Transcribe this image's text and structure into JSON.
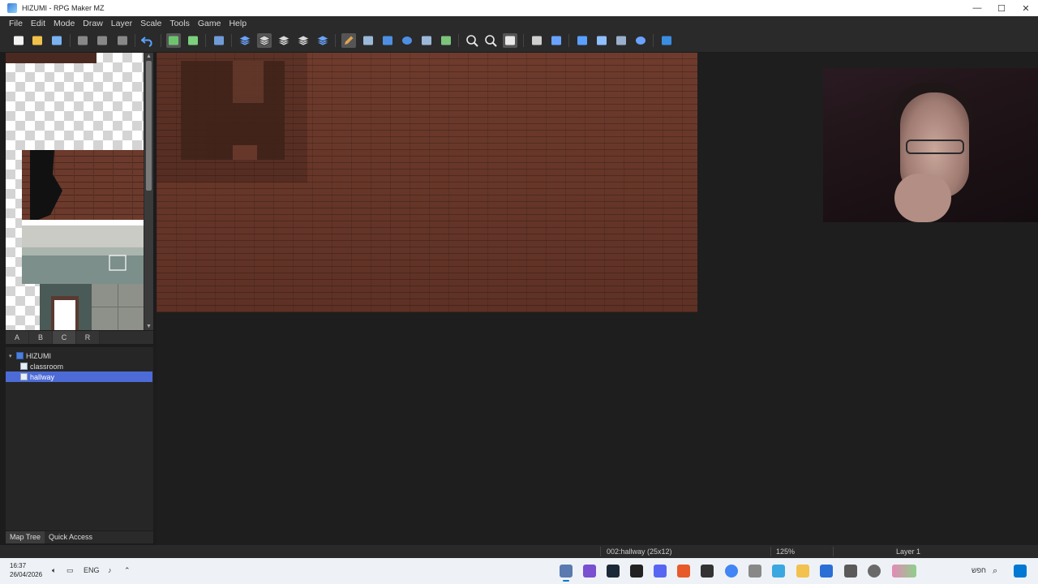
{
  "window": {
    "title": "HIZUMI - RPG Maker MZ",
    "minimize": "—",
    "maximize": "☐",
    "close": "✕"
  },
  "menu": [
    "File",
    "Edit",
    "Mode",
    "Draw",
    "Layer",
    "Scale",
    "Tools",
    "Game",
    "Help"
  ],
  "toolbar": [
    {
      "name": "new-project-icon",
      "color": "#f3f3f3",
      "active": false
    },
    {
      "name": "open-project-icon",
      "color": "#f0c24b",
      "active": false
    },
    {
      "name": "save-project-icon",
      "color": "#7ab3f0",
      "active": false
    },
    {
      "name": "cut-icon",
      "color": "#888888",
      "active": false
    },
    {
      "name": "copy-icon",
      "color": "#888888",
      "active": false
    },
    {
      "name": "paste-icon",
      "color": "#888888",
      "active": false
    },
    {
      "name": "undo-icon",
      "color": "#5aa0ff",
      "active": false
    },
    {
      "name": "map-mode-icon",
      "color": "#6ec46e",
      "active": true
    },
    {
      "name": "region-mode-icon",
      "color": "#7ccf7c",
      "active": false
    },
    {
      "name": "event-mode-icon",
      "color": "#6f9cd8",
      "active": false
    },
    {
      "name": "layer-1-icon",
      "color": "#6aa3ff",
      "active": false
    },
    {
      "name": "layer-2-icon",
      "color": "#d8d8d8",
      "active": true
    },
    {
      "name": "layer-3-icon",
      "color": "#d8d8d8",
      "active": false
    },
    {
      "name": "layer-4-icon",
      "color": "#d8d8d8",
      "active": false
    },
    {
      "name": "auto-layer-icon",
      "color": "#6aa3ff",
      "active": false
    },
    {
      "name": "pencil-icon",
      "color": "#e3a44f",
      "active": true
    },
    {
      "name": "eraser-icon",
      "color": "#9bb8d9",
      "active": false
    },
    {
      "name": "rectangle-icon",
      "color": "#4f8fe3",
      "active": false
    },
    {
      "name": "ellipse-icon",
      "color": "#4f8fe3",
      "active": false
    },
    {
      "name": "flood-fill-icon",
      "color": "#9bb8d9",
      "active": false
    },
    {
      "name": "shadow-pen-icon",
      "color": "#7cc47c",
      "active": false
    },
    {
      "name": "zoom-in-icon",
      "color": "#e8e8e8",
      "active": false
    },
    {
      "name": "zoom-out-icon",
      "color": "#e8e8e8",
      "active": false
    },
    {
      "name": "actual-size-icon",
      "color": "#e8e8e8",
      "active": true
    },
    {
      "name": "database-icon",
      "color": "#cfcfcf",
      "active": false
    },
    {
      "name": "plugin-manager-icon",
      "color": "#6aa3ff",
      "active": false
    },
    {
      "name": "sound-test-icon",
      "color": "#5aa0ff",
      "active": false
    },
    {
      "name": "event-searcher-icon",
      "color": "#8ec0ff",
      "active": false
    },
    {
      "name": "resource-manager-icon",
      "color": "#9ab0cc",
      "active": false
    },
    {
      "name": "character-generator-icon",
      "color": "#6aa3ff",
      "active": false
    },
    {
      "name": "playtest-icon",
      "color": "#3b8de0",
      "active": false
    }
  ],
  "tileset": {
    "tabs": [
      "A",
      "B",
      "C",
      "R"
    ],
    "selected_tab": "C"
  },
  "map_tree": {
    "project": "HIZUMI",
    "maps": [
      {
        "label": "classroom",
        "selected": false
      },
      {
        "label": "hallway",
        "selected": true
      }
    ]
  },
  "bottom_tabs": [
    "Map Tree",
    "Quick Access"
  ],
  "status": {
    "map": "002:hallway (25x12)",
    "zoom": "125%",
    "layer": "Layer 1"
  },
  "taskbar": {
    "time": "16:37",
    "date": "26/04/2026",
    "lang": "ENG",
    "right_label": "חפש"
  }
}
